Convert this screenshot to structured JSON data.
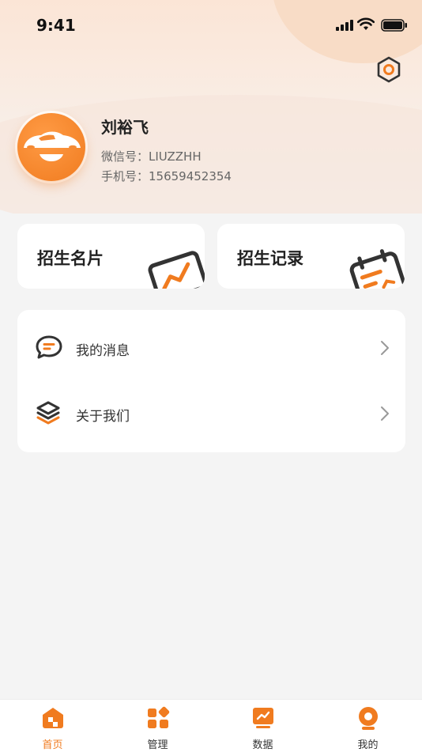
{
  "status_bar": {
    "time": "9:41"
  },
  "profile": {
    "name": "刘裕飞",
    "wechat_line": "微信号：LIUZZHH",
    "phone_line": "手机号：15659452354"
  },
  "cards": [
    {
      "title": "招生名片",
      "icon": "chart-card-icon"
    },
    {
      "title": "招生记录",
      "icon": "calendar-record-icon"
    }
  ],
  "menu": [
    {
      "label": "我的消息",
      "icon": "message-bubble-icon"
    },
    {
      "label": "关于我们",
      "icon": "layers-icon"
    }
  ],
  "tabbar": [
    {
      "label": "首页",
      "icon": "home-icon",
      "active": true
    },
    {
      "label": "管理",
      "icon": "grid-apps-icon",
      "active": false
    },
    {
      "label": "数据",
      "icon": "data-chart-icon",
      "active": false
    },
    {
      "label": "我的",
      "icon": "profile-icon",
      "active": false
    }
  ],
  "colors": {
    "accent": "#f07b1f",
    "background": "#f4f4f4",
    "card": "#ffffff",
    "dark_icon": "#333333"
  }
}
